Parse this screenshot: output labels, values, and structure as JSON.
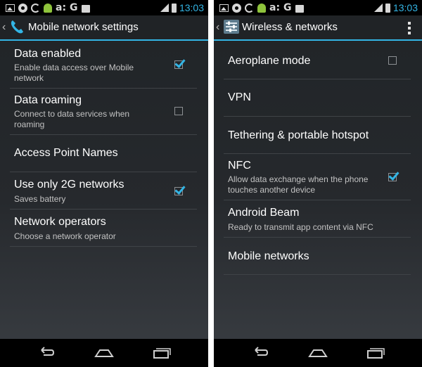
{
  "status_bar": {
    "time": "13:03",
    "notification_icons": [
      "image-icon",
      "round-icon",
      "sync-icon",
      "android-icon",
      "letter-a-icon",
      "google-icon",
      "bag-icon"
    ],
    "letters": {
      "a": "a:",
      "g": "G"
    },
    "right_icons": [
      "signal-icon",
      "battery-icon"
    ]
  },
  "left_screen": {
    "title": "Mobile network settings",
    "icon": "phone-handset-icon",
    "items": [
      {
        "label": "Data enabled",
        "summary": "Enable data access over Mobile network",
        "checkbox": true,
        "checked": true
      },
      {
        "label": "Data roaming",
        "summary": "Connect to data services when roaming",
        "checkbox": true,
        "checked": false
      },
      {
        "label": "Access Point Names",
        "summary": "",
        "checkbox": false
      },
      {
        "label": "Use only 2G networks",
        "summary": "Saves battery",
        "checkbox": true,
        "checked": true
      },
      {
        "label": "Network operators",
        "summary": "Choose a network operator",
        "checkbox": false
      }
    ]
  },
  "right_screen": {
    "title": "Wireless & networks",
    "icon": "settings-icon",
    "items": [
      {
        "label": "Aeroplane mode",
        "summary": "",
        "checkbox": true,
        "checked": false
      },
      {
        "label": "VPN",
        "summary": "",
        "checkbox": false
      },
      {
        "label": "Tethering & portable hotspot",
        "summary": "",
        "checkbox": false
      },
      {
        "label": "NFC",
        "summary": "Allow data exchange when the phone touches another device",
        "checkbox": true,
        "checked": true
      },
      {
        "label": "Android Beam",
        "summary": "Ready to transmit app content via NFC",
        "checkbox": false
      },
      {
        "label": "Mobile networks",
        "summary": "",
        "checkbox": false
      }
    ]
  },
  "nav_bar": {
    "buttons": [
      "back-icon",
      "home-icon",
      "recents-icon"
    ]
  },
  "colors": {
    "accent": "#33b5e5",
    "background": "#24272a",
    "status_bar": "#000000",
    "text": "#ffffff",
    "summary": "#c2c2c2"
  }
}
